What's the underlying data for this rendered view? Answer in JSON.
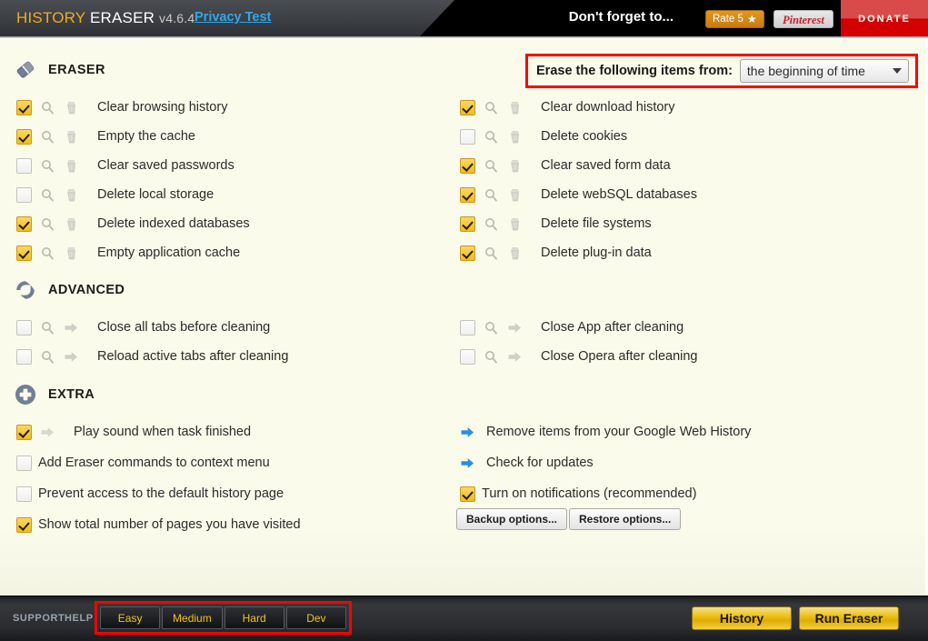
{
  "header": {
    "brand_history": "HISTORY",
    "brand_eraser": "ERASER",
    "version": "v4.6.4",
    "privacy_test": "Privacy Test",
    "dont_forget": "Don't forget to...",
    "rate_label": "Rate 5",
    "rate_star": "★",
    "pinterest_label": "Pinterest",
    "donate_label": "DONATE",
    "accent_gold": "#f0ad1e",
    "accent_blue": "#2fa8ea",
    "donate_red": "#d40000"
  },
  "erase_from": {
    "label": "Erase the following items from:",
    "selected": "the beginning of time",
    "highlight_color": "#ff0000"
  },
  "sections": {
    "eraser": {
      "title": "ERASER",
      "icon": "eraser-icon",
      "left_items": [
        {
          "label": "Clear browsing history",
          "checked": true
        },
        {
          "label": "Empty the cache",
          "checked": true
        },
        {
          "label": "Clear saved passwords",
          "checked": false
        },
        {
          "label": "Delete local storage",
          "checked": false
        },
        {
          "label": "Delete indexed databases",
          "checked": true
        },
        {
          "label": "Empty application cache",
          "checked": true
        }
      ],
      "right_items": [
        {
          "label": "Clear download history",
          "checked": true
        },
        {
          "label": "Delete cookies",
          "checked": false
        },
        {
          "label": "Clear saved form data",
          "checked": true
        },
        {
          "label": "Delete webSQL databases",
          "checked": true
        },
        {
          "label": "Delete file systems",
          "checked": true
        },
        {
          "label": "Delete plug-in data",
          "checked": true
        }
      ]
    },
    "advanced": {
      "title": "ADVANCED",
      "icon": "refresh-cycle-icon",
      "left_items": [
        {
          "label": "Close all tabs before cleaning",
          "checked": false
        },
        {
          "label": "Reload active tabs after cleaning",
          "checked": false
        }
      ],
      "right_items": [
        {
          "label": "Close App after cleaning",
          "checked": false
        },
        {
          "label": "Close Opera after cleaning",
          "checked": false
        }
      ]
    },
    "extra": {
      "title": "EXTRA",
      "icon": "plus-circle-icon",
      "left_items": [
        {
          "label": "Play sound when task finished",
          "checked": true,
          "arrow": true
        },
        {
          "label": "Add Eraser commands to context menu",
          "checked": false,
          "arrow": false
        },
        {
          "label": "Prevent access to the default history page",
          "checked": false,
          "arrow": false
        },
        {
          "label": "Show total number of pages you have visited",
          "checked": true,
          "arrow": false
        }
      ],
      "right_links": [
        {
          "label": "Remove items from your Google Web History"
        },
        {
          "label": "Check for updates"
        }
      ],
      "right_checkbox": {
        "label": "Turn on notifications (recommended)",
        "checked": true
      },
      "backup_label": "Backup options...",
      "restore_label": "Restore options..."
    }
  },
  "footer": {
    "support": "SUPPORT",
    "help": "HELP",
    "levels": [
      "Easy",
      "Medium",
      "Hard",
      "Dev"
    ],
    "history_label": "History",
    "run_eraser_label": "Run Eraser",
    "level_text_color": "#f2c517",
    "gold_button_color": "#edc318"
  }
}
